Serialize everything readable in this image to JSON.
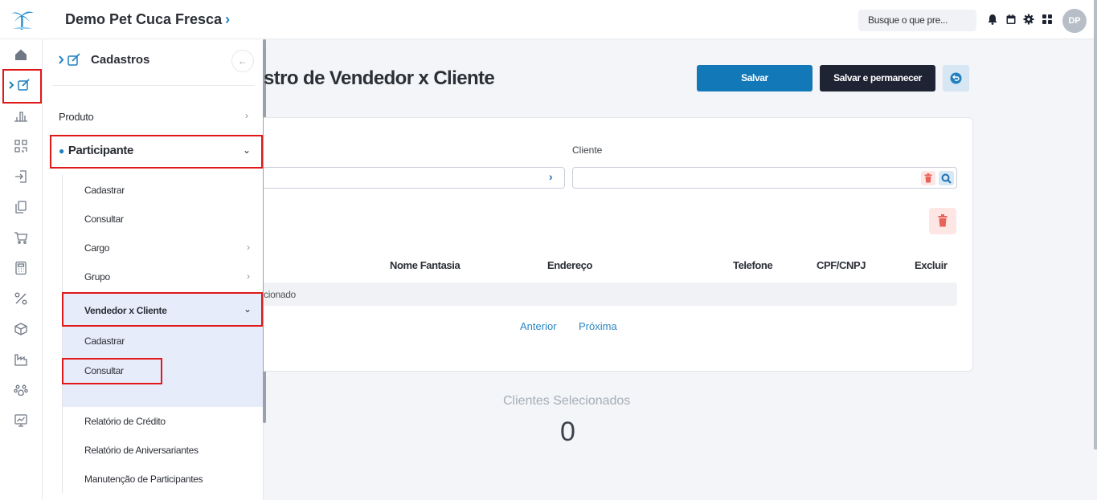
{
  "header": {
    "company": "Demo Pet Cuca Fresca",
    "company_chevron": "›",
    "search_placeholder": "Busque o que pre...",
    "icons": [
      "bell-icon",
      "calendar-icon",
      "gear-icon",
      "apps-grid-icon"
    ],
    "avatar": "DP"
  },
  "rail": {
    "icons": [
      "home-icon",
      "edit-icon",
      "bar-chart-icon",
      "scan-icon",
      "login-icon",
      "documents-icon",
      "cart-icon",
      "calculator-icon",
      "percent-icon",
      "box-icon",
      "factory-icon",
      "paw-icon",
      "trend-chart-icon"
    ]
  },
  "flyout": {
    "title": "Cadastros",
    "back_icon": "←",
    "items": {
      "produto": "Produto",
      "participante": "Participante",
      "cadastrar": "Cadastrar",
      "consultar": "Consultar",
      "cargo": "Cargo",
      "grupo": "Grupo",
      "vendedor_cliente": "Vendedor x Cliente",
      "vc_cadastrar": "Cadastrar",
      "vc_consultar": "Consultar",
      "relatorio_credito": "Relatório de Crédito",
      "relatorio_aniversariantes": "Relatório de Aniversariantes",
      "manutencao": "Manutenção de Participantes"
    }
  },
  "main": {
    "title": "stro de Vendedor x Cliente",
    "save": "Salvar",
    "save_stay": "Salvar e permanecer",
    "cliente_label": "Cliente",
    "table_headers": {
      "nome_fantasia": "Nome Fantasia",
      "endereco": "Endereço",
      "telefone": "Telefone",
      "cpf_cnpj": "CPF/CNPJ",
      "excluir": "Excluir"
    },
    "empty_text": "cionado",
    "prev": "Anterior",
    "next": "Próxima",
    "selected_label": "Clientes Selecionados",
    "selected_count": "0"
  },
  "colors": {
    "primary": "#1378b8",
    "dark": "#1e2433",
    "highlight": "#e01818",
    "link": "#2c86c2"
  }
}
